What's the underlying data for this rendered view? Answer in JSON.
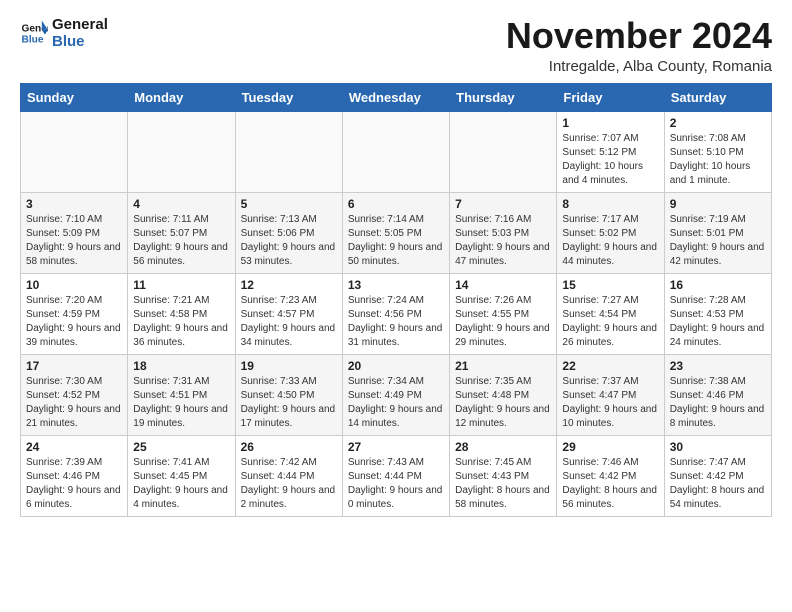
{
  "logo": {
    "line1": "General",
    "line2": "Blue"
  },
  "title": "November 2024",
  "subtitle": "Intregalde, Alba County, Romania",
  "weekdays": [
    "Sunday",
    "Monday",
    "Tuesday",
    "Wednesday",
    "Thursday",
    "Friday",
    "Saturday"
  ],
  "weeks": [
    [
      {
        "day": "",
        "info": ""
      },
      {
        "day": "",
        "info": ""
      },
      {
        "day": "",
        "info": ""
      },
      {
        "day": "",
        "info": ""
      },
      {
        "day": "",
        "info": ""
      },
      {
        "day": "1",
        "info": "Sunrise: 7:07 AM\nSunset: 5:12 PM\nDaylight: 10 hours and 4 minutes."
      },
      {
        "day": "2",
        "info": "Sunrise: 7:08 AM\nSunset: 5:10 PM\nDaylight: 10 hours and 1 minute."
      }
    ],
    [
      {
        "day": "3",
        "info": "Sunrise: 7:10 AM\nSunset: 5:09 PM\nDaylight: 9 hours and 58 minutes."
      },
      {
        "day": "4",
        "info": "Sunrise: 7:11 AM\nSunset: 5:07 PM\nDaylight: 9 hours and 56 minutes."
      },
      {
        "day": "5",
        "info": "Sunrise: 7:13 AM\nSunset: 5:06 PM\nDaylight: 9 hours and 53 minutes."
      },
      {
        "day": "6",
        "info": "Sunrise: 7:14 AM\nSunset: 5:05 PM\nDaylight: 9 hours and 50 minutes."
      },
      {
        "day": "7",
        "info": "Sunrise: 7:16 AM\nSunset: 5:03 PM\nDaylight: 9 hours and 47 minutes."
      },
      {
        "day": "8",
        "info": "Sunrise: 7:17 AM\nSunset: 5:02 PM\nDaylight: 9 hours and 44 minutes."
      },
      {
        "day": "9",
        "info": "Sunrise: 7:19 AM\nSunset: 5:01 PM\nDaylight: 9 hours and 42 minutes."
      }
    ],
    [
      {
        "day": "10",
        "info": "Sunrise: 7:20 AM\nSunset: 4:59 PM\nDaylight: 9 hours and 39 minutes."
      },
      {
        "day": "11",
        "info": "Sunrise: 7:21 AM\nSunset: 4:58 PM\nDaylight: 9 hours and 36 minutes."
      },
      {
        "day": "12",
        "info": "Sunrise: 7:23 AM\nSunset: 4:57 PM\nDaylight: 9 hours and 34 minutes."
      },
      {
        "day": "13",
        "info": "Sunrise: 7:24 AM\nSunset: 4:56 PM\nDaylight: 9 hours and 31 minutes."
      },
      {
        "day": "14",
        "info": "Sunrise: 7:26 AM\nSunset: 4:55 PM\nDaylight: 9 hours and 29 minutes."
      },
      {
        "day": "15",
        "info": "Sunrise: 7:27 AM\nSunset: 4:54 PM\nDaylight: 9 hours and 26 minutes."
      },
      {
        "day": "16",
        "info": "Sunrise: 7:28 AM\nSunset: 4:53 PM\nDaylight: 9 hours and 24 minutes."
      }
    ],
    [
      {
        "day": "17",
        "info": "Sunrise: 7:30 AM\nSunset: 4:52 PM\nDaylight: 9 hours and 21 minutes."
      },
      {
        "day": "18",
        "info": "Sunrise: 7:31 AM\nSunset: 4:51 PM\nDaylight: 9 hours and 19 minutes."
      },
      {
        "day": "19",
        "info": "Sunrise: 7:33 AM\nSunset: 4:50 PM\nDaylight: 9 hours and 17 minutes."
      },
      {
        "day": "20",
        "info": "Sunrise: 7:34 AM\nSunset: 4:49 PM\nDaylight: 9 hours and 14 minutes."
      },
      {
        "day": "21",
        "info": "Sunrise: 7:35 AM\nSunset: 4:48 PM\nDaylight: 9 hours and 12 minutes."
      },
      {
        "day": "22",
        "info": "Sunrise: 7:37 AM\nSunset: 4:47 PM\nDaylight: 9 hours and 10 minutes."
      },
      {
        "day": "23",
        "info": "Sunrise: 7:38 AM\nSunset: 4:46 PM\nDaylight: 9 hours and 8 minutes."
      }
    ],
    [
      {
        "day": "24",
        "info": "Sunrise: 7:39 AM\nSunset: 4:46 PM\nDaylight: 9 hours and 6 minutes."
      },
      {
        "day": "25",
        "info": "Sunrise: 7:41 AM\nSunset: 4:45 PM\nDaylight: 9 hours and 4 minutes."
      },
      {
        "day": "26",
        "info": "Sunrise: 7:42 AM\nSunset: 4:44 PM\nDaylight: 9 hours and 2 minutes."
      },
      {
        "day": "27",
        "info": "Sunrise: 7:43 AM\nSunset: 4:44 PM\nDaylight: 9 hours and 0 minutes."
      },
      {
        "day": "28",
        "info": "Sunrise: 7:45 AM\nSunset: 4:43 PM\nDaylight: 8 hours and 58 minutes."
      },
      {
        "day": "29",
        "info": "Sunrise: 7:46 AM\nSunset: 4:42 PM\nDaylight: 8 hours and 56 minutes."
      },
      {
        "day": "30",
        "info": "Sunrise: 7:47 AM\nSunset: 4:42 PM\nDaylight: 8 hours and 54 minutes."
      }
    ]
  ]
}
